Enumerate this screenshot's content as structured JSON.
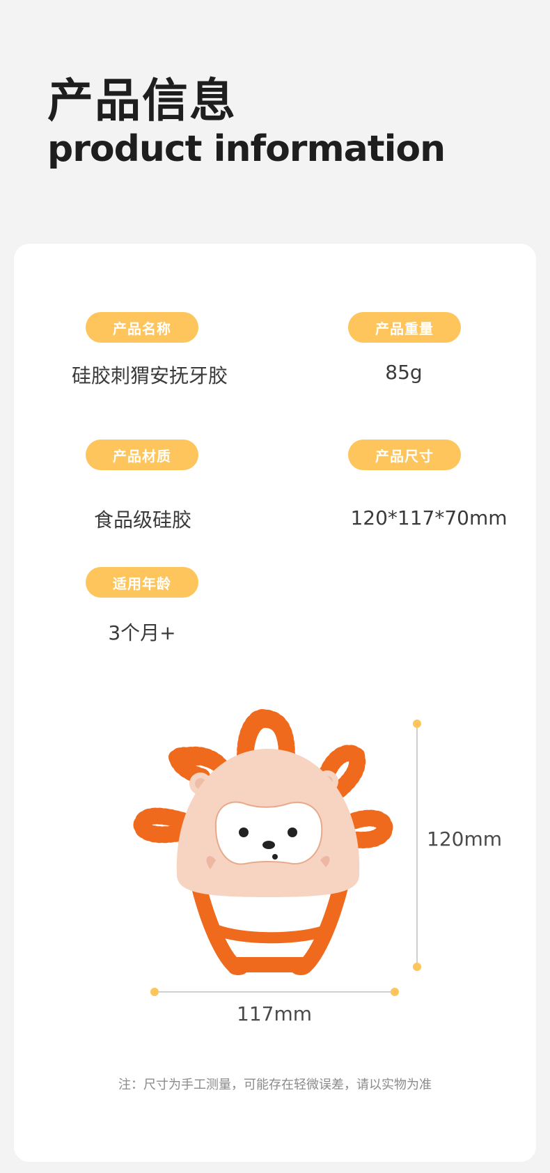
{
  "header": {
    "title_cn": "产品信息",
    "title_en": "product information"
  },
  "specs": [
    {
      "label": "产品名称",
      "value": "硅胶刺猬安抚牙胶"
    },
    {
      "label": "产品重量",
      "value": "85g"
    },
    {
      "label": "产品材质",
      "value": "食品级硅胶"
    },
    {
      "label": "产品尺寸",
      "value": "120*117*70mm"
    },
    {
      "label": "适用年龄",
      "value": "3个月+"
    }
  ],
  "dimensions": {
    "height": "120mm",
    "width": "117mm"
  },
  "note": "注：尺寸为手工测量，可能存在轻微误差，请以实物为准",
  "colors": {
    "pill": "#fdc55b",
    "accent_orange": "#f06a1e",
    "body_pink": "#f7d3c2",
    "background": "#f3f3f3"
  }
}
